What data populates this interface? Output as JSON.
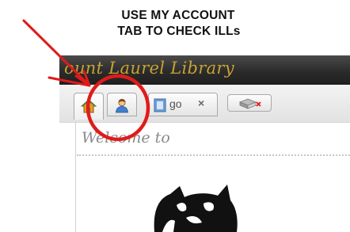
{
  "caption": {
    "line1": "USE MY ACCOUNT",
    "line2": "TAB TO CHECK ILLs"
  },
  "header": {
    "title": "ount Laurel Library"
  },
  "tabs": [
    {
      "icon": "home-icon"
    },
    {
      "icon": "user-icon"
    },
    {
      "icon": "catalog-icon",
      "label": "go",
      "close": "×"
    },
    {
      "icon": "new-tab-icon"
    }
  ],
  "content": {
    "welcome": "Welcome to"
  },
  "colors": {
    "annotation_red": "#e01b1b",
    "header_gold": "#c7a233",
    "header_bg": "#2b2b2b"
  }
}
